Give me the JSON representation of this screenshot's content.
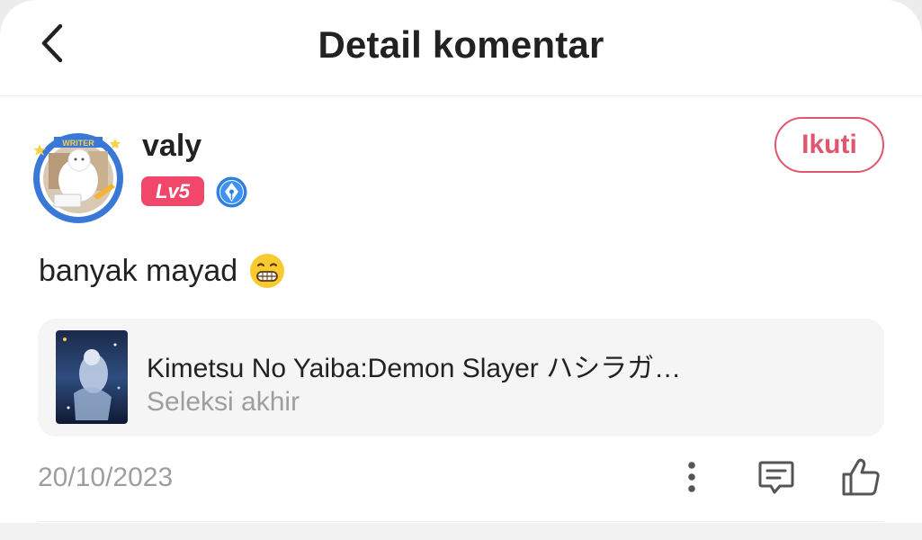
{
  "header": {
    "title": "Detail komentar",
    "back_icon": "chevron-left-icon"
  },
  "user": {
    "name": "valy",
    "avatar_badge_text": "WRITER",
    "level": "Lv5",
    "writer_badge_icon": "pen-nib-icon",
    "follow_label": "Ikuti"
  },
  "comment": {
    "text": "banyak mayad",
    "emoji_icon": "grinning-face-emoji"
  },
  "book": {
    "title": "Kimetsu No Yaiba:Demon Slayer ハシラガ…",
    "status": "Seleksi akhir"
  },
  "meta": {
    "date": "20/10/2023",
    "more_icon": "more-vertical-icon",
    "reply_icon": "comment-icon",
    "like_icon": "thumbs-up-icon"
  },
  "colors": {
    "accent": "#e0566f",
    "level_badge": "#f0476b",
    "writer_badge": "#2f7fe0",
    "muted_text": "#9e9e9e"
  }
}
